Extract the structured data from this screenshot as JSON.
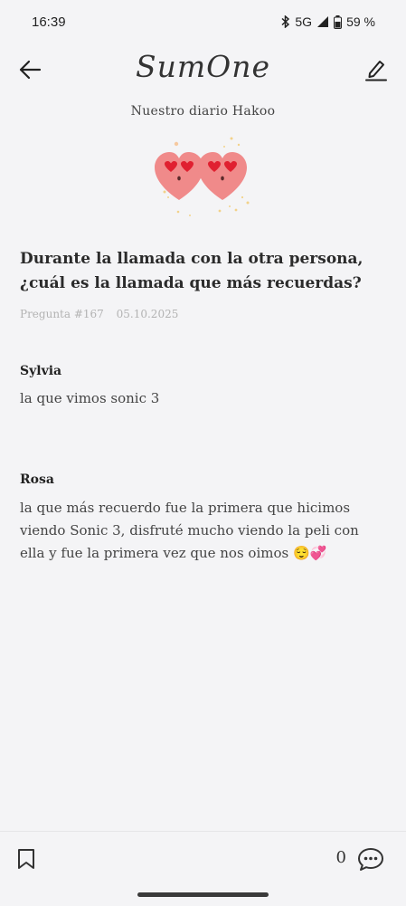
{
  "status": {
    "time": "16:39",
    "network": "5G",
    "battery": "59 %"
  },
  "header": {
    "logo": "SumOne"
  },
  "diary_name": "Nuestro diario Hakoo",
  "question": {
    "text": "Durante la llamada con la otra persona, ¿cuál es la llamada que más recuerdas?",
    "number": "Pregunta #167",
    "date": "05.10.2025"
  },
  "answers": [
    {
      "name": "Sylvia",
      "text": "la que vimos sonic 3"
    },
    {
      "name": "Rosa",
      "text": "la que más recuerdo fue la primera que hicimos viendo Sonic 3, disfruté mucho viendo la peli con ella y fue la primera vez que nos oimos 😌💞"
    }
  ],
  "footer": {
    "comment_count": "0"
  },
  "icons": [
    "bluetooth-icon",
    "signal-icon",
    "battery-icon",
    "back-arrow-icon",
    "edit-pen-icon",
    "hearts-illustration",
    "bookmark-icon",
    "comment-icon"
  ],
  "colors": {
    "background": "#f4f4f6",
    "heart": "#f08a8a",
    "heart_eye": "#e02030"
  }
}
